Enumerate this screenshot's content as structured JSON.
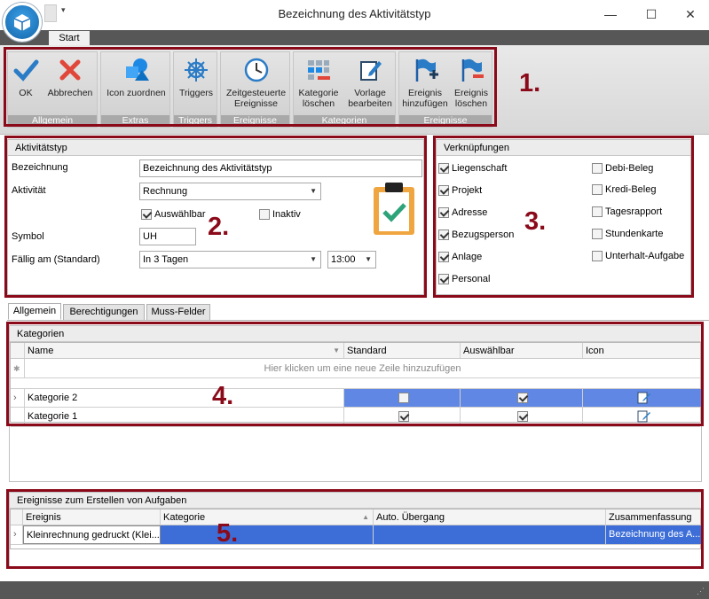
{
  "window": {
    "title": "Bezeichnung des Aktivitätstyp",
    "minimize": "—",
    "maximize": "☐",
    "close": "✕"
  },
  "ribbon": {
    "tab": "Start",
    "groups": [
      {
        "label": "Allgemein",
        "buttons": [
          {
            "label": "OK"
          },
          {
            "label": "Abbrechen"
          }
        ]
      },
      {
        "label": "Extras",
        "buttons": [
          {
            "label": "Icon zuordnen"
          }
        ]
      },
      {
        "label": "Triggers",
        "buttons": [
          {
            "label": "Triggers"
          }
        ]
      },
      {
        "label": "Ereignisse",
        "buttons": [
          {
            "label_1": "Zeitgesteuerte",
            "label_2": "Ereignisse"
          }
        ]
      },
      {
        "label": "Kategorien",
        "buttons": [
          {
            "label_1": "Kategorie",
            "label_2": "löschen"
          },
          {
            "label_1": "Vorlage",
            "label_2": "bearbeiten"
          }
        ]
      },
      {
        "label": "Ereignisse",
        "buttons": [
          {
            "label_1": "Ereignis",
            "label_2": "hinzufügen"
          },
          {
            "label_1": "Ereignis",
            "label_2": "löschen"
          }
        ]
      }
    ]
  },
  "markers": {
    "m1": "1.",
    "m2": "2.",
    "m3": "3.",
    "m4": "4.",
    "m5": "5."
  },
  "aktivitaetstyp": {
    "header": "Aktivitätstyp",
    "bezeichnung_label": "Bezeichnung",
    "bezeichnung_value": "Bezeichnung des Aktivitätstyp",
    "aktivitaet_label": "Aktivität",
    "aktivitaet_value": "Rechnung",
    "auswaehlbar_label": "Auswählbar",
    "auswaehlbar_checked": true,
    "inaktiv_label": "Inaktiv",
    "inaktiv_checked": false,
    "symbol_label": "Symbol",
    "symbol_value": "UH",
    "faellig_label": "Fällig am (Standard)",
    "faellig_value": "In 3 Tagen",
    "zeit_value": "13:00"
  },
  "verknuepfungen": {
    "header": "Verknüpfungen",
    "left": [
      {
        "label": "Liegenschaft",
        "checked": true
      },
      {
        "label": "Projekt",
        "checked": true
      },
      {
        "label": "Adresse",
        "checked": true
      },
      {
        "label": "Bezugsperson",
        "checked": true
      },
      {
        "label": "Anlage",
        "checked": true
      },
      {
        "label": "Personal",
        "checked": true
      }
    ],
    "right": [
      {
        "label": "Debi-Beleg",
        "checked": false
      },
      {
        "label": "Kredi-Beleg",
        "checked": false
      },
      {
        "label": "Tagesrapport",
        "checked": false
      },
      {
        "label": "Stundenkarte",
        "checked": false
      },
      {
        "label": "Unterhalt-Aufgabe",
        "checked": false
      }
    ]
  },
  "tabs": [
    {
      "label": "Allgemein"
    },
    {
      "label": "Berechtigungen"
    },
    {
      "label": "Muss-Felder"
    }
  ],
  "kategorien": {
    "header": "Kategorien",
    "columns": {
      "name": "Name",
      "standard": "Standard",
      "auswaehlbar": "Auswählbar",
      "icon": "Icon"
    },
    "new_row": "Hier klicken um eine neue Zeile hinzuzufügen",
    "rows": [
      {
        "name": "Kategorie 2",
        "standard": false,
        "auswaehlbar": true
      },
      {
        "name": "Kategorie 1",
        "standard": true,
        "auswaehlbar": true
      }
    ]
  },
  "ereignisse": {
    "header": "Ereignisse zum Erstellen von Aufgaben",
    "columns": {
      "ereignis": "Ereignis",
      "kategorie": "Kategorie",
      "auto": "Auto. Übergang",
      "zusammenfassung": "Zusammenfassung"
    },
    "rows": [
      {
        "ereignis": "Kleinrechnung gedruckt (Klei...",
        "kategorie": "",
        "auto": "",
        "zusammenfassung": "Bezeichnung des A..."
      }
    ]
  },
  "colors": {
    "accent_red": "#8b0a1a",
    "selection_blue": "#3d6ed8",
    "ribbon_label_bg": "#a9a9a9"
  }
}
